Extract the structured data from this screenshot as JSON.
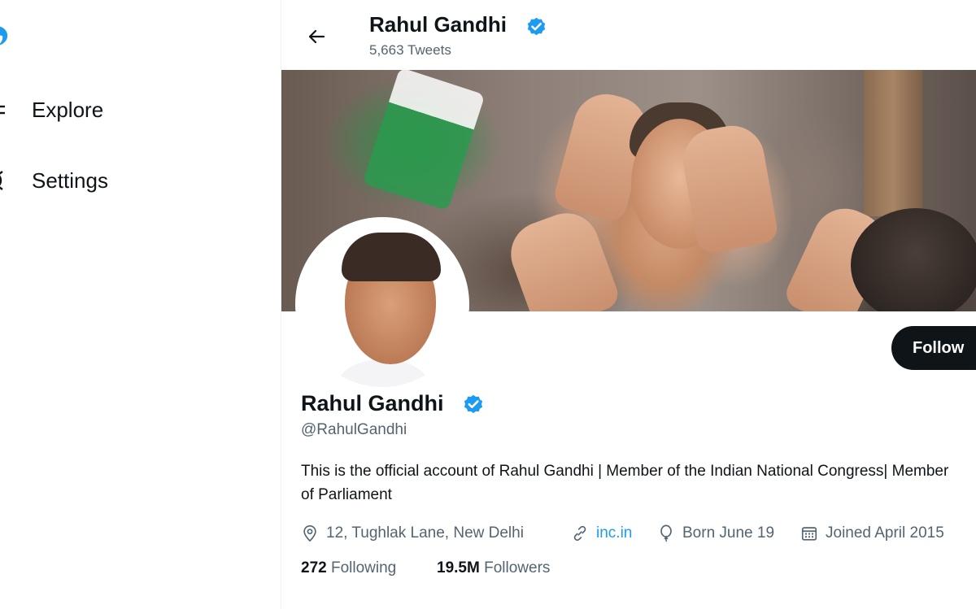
{
  "colors": {
    "accent": "#1d9bf0",
    "text_primary": "#0f1419",
    "text_secondary": "#536471",
    "follow_bg": "#0f1419"
  },
  "sidebar": {
    "logo_icon": "bird-logo-icon",
    "items": [
      {
        "label": "Explore",
        "icon": "hashtag-icon"
      },
      {
        "label": "Settings",
        "icon": "gear-icon"
      }
    ]
  },
  "header": {
    "back_icon": "arrow-left-icon",
    "name": "Rahul Gandhi",
    "tweet_count": "5,663 Tweets",
    "verified_icon": "verified-badge-icon"
  },
  "profile": {
    "name": "Rahul Gandhi",
    "handle": "@RahulGandhi",
    "bio": "This is the official account of Rahul Gandhi | Member of the Indian National Congress| Member of Parliament",
    "follow_label": "Follow",
    "location": "12, Tughlak Lane, New Delhi",
    "website": "inc.in",
    "born": "Born June 19",
    "joined": "Joined April 2015",
    "following_count": "272",
    "following_label": "Following",
    "followers_count": "19.5M",
    "followers_label": "Followers"
  }
}
